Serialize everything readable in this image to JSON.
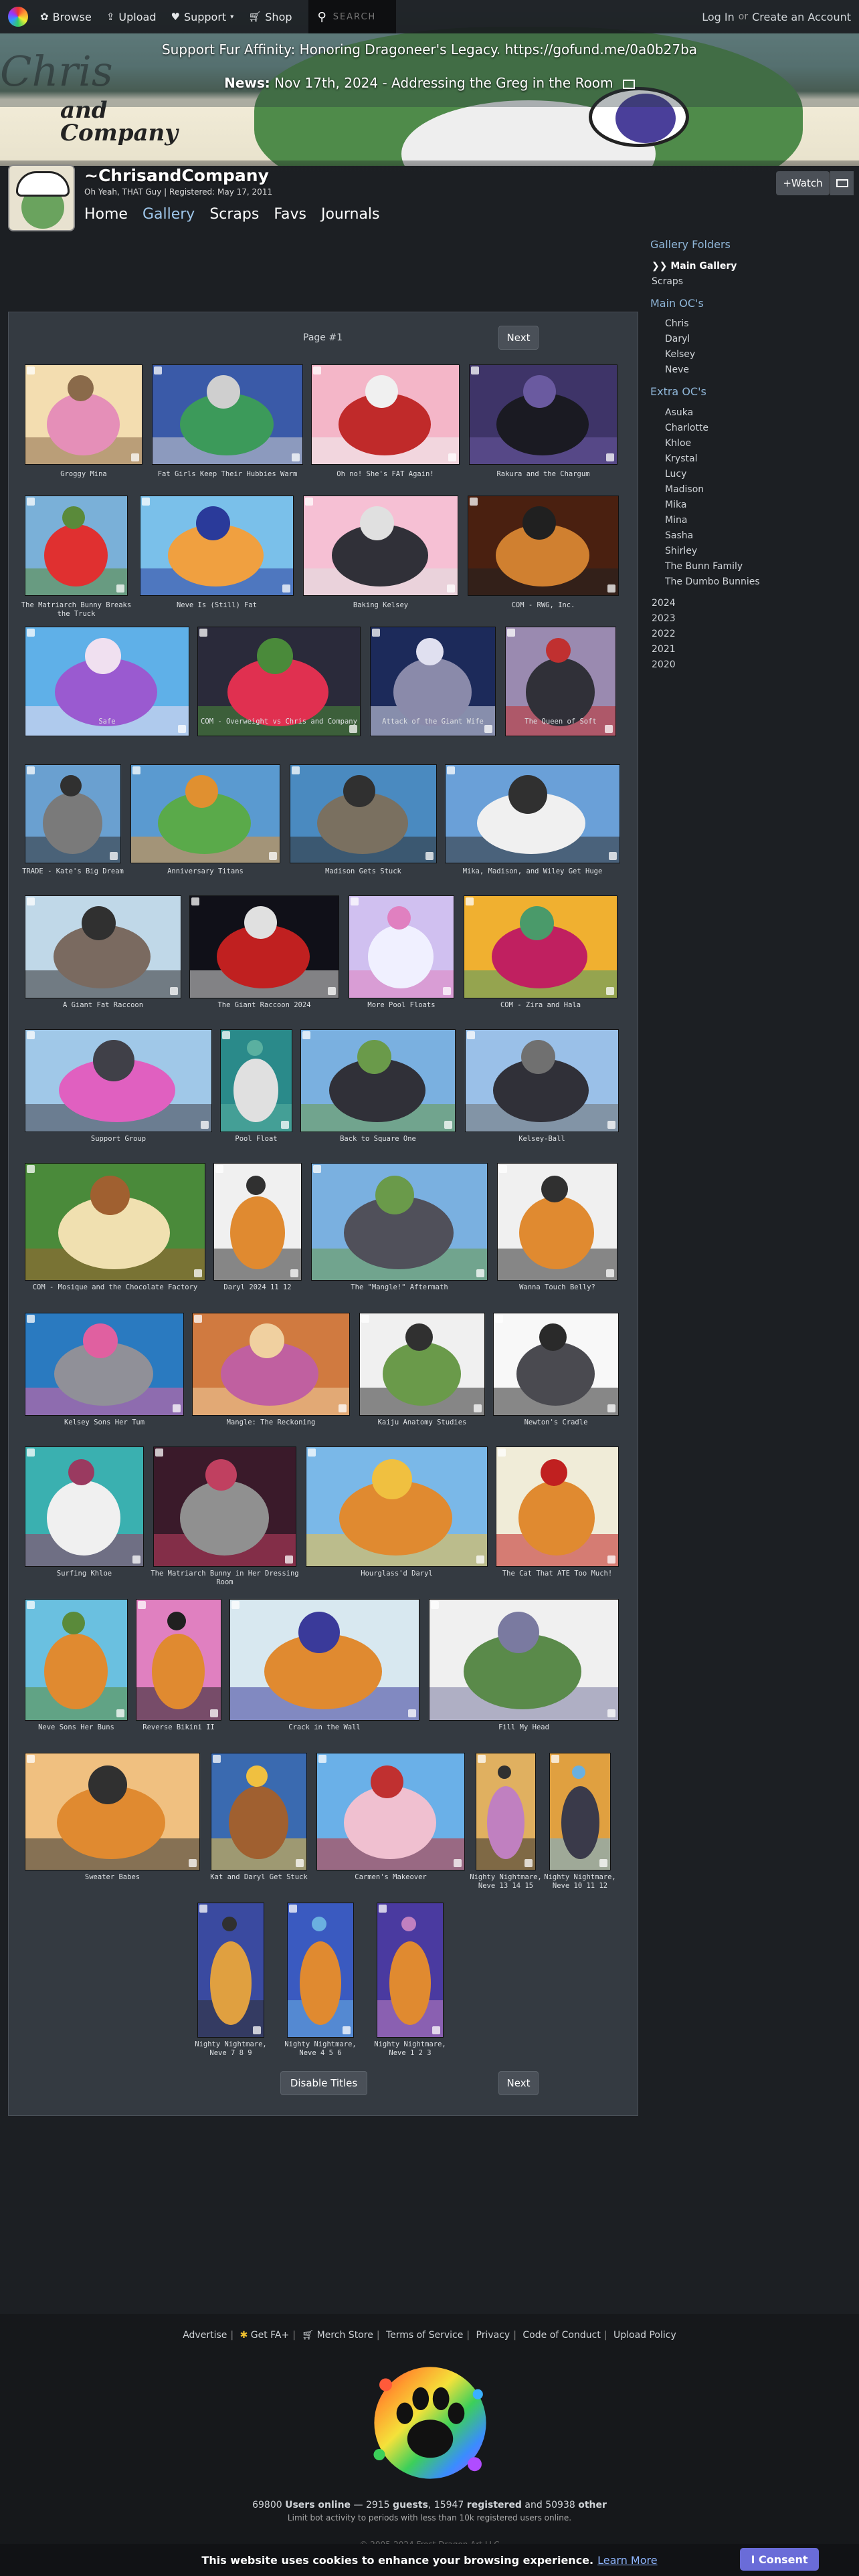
{
  "nav": {
    "browse": "Browse",
    "upload": "Upload",
    "support": "Support",
    "shop": "Shop",
    "search_placeholder": "SEARCH",
    "login": "Log In",
    "or": "or",
    "create_account": "Create an Account"
  },
  "banner": {
    "affinity": "Support Fur Affinity: Honoring Dragoneer's Legacy. https://gofund.me/0a0b27ba",
    "news_label": "News:",
    "news_text": "Nov 17th, 2024 - Addressing the Greg in the Room",
    "logo_line1": "Chris",
    "logo_line2": "and",
    "logo_line3": "Company"
  },
  "user": {
    "name": "~ChrisandCompany",
    "sub": "Oh Yeah, THAT Guy | Registered: May 17, 2011",
    "watch": "+Watch",
    "tabs": [
      "Home",
      "Gallery",
      "Scraps",
      "Favs",
      "Journals"
    ]
  },
  "gallery": {
    "page_label": "Page #1",
    "next": "Next",
    "disable_titles": "Disable Titles",
    "items": [
      {
        "title": "Groggy Mina",
        "colors": [
          "#f3ddb0",
          "#e58fb8",
          "#8a6a4a"
        ]
      },
      {
        "title": "Fat Girls Keep Their Hubbies Warm",
        "colors": [
          "#3a5aa8",
          "#3c9a5a",
          "#cfcfcf"
        ]
      },
      {
        "title": "Oh no! She's FAT Again!",
        "colors": [
          "#f4b6c8",
          "#c02a2a",
          "#f0f0f0"
        ]
      },
      {
        "title": "Rakura and the Chargum",
        "colors": [
          "#3e3468",
          "#1a1a22",
          "#6a5aa0"
        ]
      },
      {
        "title": "The Matriarch Bunny Breaks the Truck",
        "colors": [
          "#7ab0d8",
          "#e03030",
          "#5a8a3a"
        ]
      },
      {
        "title": "Neve Is (Still) Fat",
        "colors": [
          "#7ac0ea",
          "#f0a040",
          "#2a3a9a"
        ]
      },
      {
        "title": "Baking Kelsey",
        "colors": [
          "#f6c0d4",
          "#303038",
          "#e0e0e0"
        ]
      },
      {
        "title": "COM - RWG, Inc.",
        "colors": [
          "#4a2010",
          "#d08030",
          "#202020"
        ]
      },
      {
        "title": "Safe",
        "colors": [
          "#5fb0e8",
          "#9a5ad0",
          "#f0e0f0"
        ]
      },
      {
        "title": "COM - Overweight vs Chris and Company",
        "colors": [
          "#2a2a3a",
          "#e03050",
          "#4a8a3a"
        ]
      },
      {
        "title": "Attack of the Giant Wife",
        "colors": [
          "#1c2a5a",
          "#8a8aaa",
          "#e0e0f0"
        ]
      },
      {
        "title": "The Queen of Soft",
        "colors": [
          "#9a8ab0",
          "#303038",
          "#c03030"
        ]
      },
      {
        "title": "TRADE - Kate's Big Dream",
        "colors": [
          "#6aa0d0",
          "#7a7a7a",
          "#303030"
        ]
      },
      {
        "title": "Anniversary Titans",
        "colors": [
          "#5a9ad0",
          "#5aaa4a",
          "#e09030"
        ]
      },
      {
        "title": "Madison Gets Stuck",
        "colors": [
          "#4a8ac0",
          "#7a7060",
          "#303030"
        ]
      },
      {
        "title": "Mika, Madison, and Wiley Get Huge",
        "colors": [
          "#6aa0d8",
          "#f0f0f0",
          "#303030"
        ]
      },
      {
        "title": "A Giant Fat Raccoon",
        "colors": [
          "#c0d8e8",
          "#7a6a60",
          "#303030"
        ]
      },
      {
        "title": "The Giant Raccoon 2024",
        "colors": [
          "#101018",
          "#c02020",
          "#e0e0e0"
        ]
      },
      {
        "title": "More Pool Floats",
        "colors": [
          "#d0c0f0",
          "#f0f0ff",
          "#e080c0"
        ]
      },
      {
        "title": "COM - Zira and Hala",
        "colors": [
          "#f0b030",
          "#c02060",
          "#4a9a6a"
        ]
      },
      {
        "title": "Support Group",
        "colors": [
          "#a0c8e8",
          "#e060c0",
          "#404048"
        ]
      },
      {
        "title": "Pool Float",
        "colors": [
          "#2a8a8a",
          "#e0e0e0",
          "#5ab0a0"
        ]
      },
      {
        "title": "Back to Square One",
        "colors": [
          "#7ab0e0",
          "#303038",
          "#6a9a4a"
        ]
      },
      {
        "title": "Kelsey-Ball",
        "colors": [
          "#9ac0e8",
          "#303038",
          "#707070"
        ]
      },
      {
        "title": "COM - Mosique and the Chocolate Factory",
        "colors": [
          "#4a8a3a",
          "#f0e0b0",
          "#a06030"
        ]
      },
      {
        "title": "Daryl 2024 11 12",
        "colors": [
          "#f0f0f0",
          "#e08a30",
          "#303030"
        ]
      },
      {
        "title": "The \"Mangle!\" Aftermath",
        "colors": [
          "#7ab0e0",
          "#50505a",
          "#6a9a4a"
        ]
      },
      {
        "title": "Wanna Touch Belly?",
        "colors": [
          "#f0f0f0",
          "#e08a30",
          "#303030"
        ]
      },
      {
        "title": "Kelsey Sons Her Tum",
        "colors": [
          "#2a7ac0",
          "#909098",
          "#e060a0"
        ]
      },
      {
        "title": "Mangle: The Reckoning",
        "colors": [
          "#d07a40",
          "#c060a0",
          "#f0d0a0"
        ]
      },
      {
        "title": "Kaiju Anatomy Studies",
        "colors": [
          "#f0f0f0",
          "#6a9a4a",
          "#303030"
        ]
      },
      {
        "title": "Newton's Cradle",
        "colors": [
          "#f8f8f8",
          "#4a4a50",
          "#2a2a2a"
        ]
      },
      {
        "title": "Surfing Khloe",
        "colors": [
          "#3ab0b0",
          "#f0f0f0",
          "#9a3a60"
        ]
      },
      {
        "title": "The Matriarch Bunny in Her Dressing Room",
        "colors": [
          "#3a1a2a",
          "#909090",
          "#c04060"
        ]
      },
      {
        "title": "Hourglass'd Daryl",
        "colors": [
          "#7ab8e8",
          "#e08a30",
          "#f0c040"
        ]
      },
      {
        "title": "The Cat That ATE Too Much!",
        "colors": [
          "#f0ecd8",
          "#e08a30",
          "#c02020"
        ]
      },
      {
        "title": "Neve Sons Her Buns",
        "colors": [
          "#6ac0e0",
          "#e08a30",
          "#5a8a3a"
        ]
      },
      {
        "title": "Reverse Bikini II",
        "colors": [
          "#e080c0",
          "#e08a30",
          "#202020"
        ]
      },
      {
        "title": "Crack in the Wall",
        "colors": [
          "#d8e8f0",
          "#e08a30",
          "#3a3a9a"
        ]
      },
      {
        "title": "Fill My Head",
        "colors": [
          "#f0f0f0",
          "#5a8a4a",
          "#7a7aa0"
        ]
      },
      {
        "title": "Sweater Babes",
        "colors": [
          "#f0c080",
          "#e08a30",
          "#303030"
        ]
      },
      {
        "title": "Kat and Daryl Get Stuck",
        "colors": [
          "#3a6ab0",
          "#a06030",
          "#f0c040"
        ]
      },
      {
        "title": "Carmen's Makeover",
        "colors": [
          "#6ab0e8",
          "#f0c0d0",
          "#c03030"
        ]
      },
      {
        "title": "Nighty Nightmare, Neve 13 14 15",
        "colors": [
          "#e0b060",
          "#c080c0",
          "#303030"
        ]
      },
      {
        "title": "Nighty Nightmare, Neve 10 11 12",
        "colors": [
          "#e0a040",
          "#3a3a4a",
          "#6ab0e0"
        ]
      },
      {
        "title": "Nighty Nightmare, Neve 7 8 9",
        "colors": [
          "#3a4aa0",
          "#e0a040",
          "#303030"
        ]
      },
      {
        "title": "Nighty Nightmare, Neve 4 5 6",
        "colors": [
          "#3a5ac0",
          "#e08a30",
          "#6ab0e0"
        ]
      },
      {
        "title": "Nighty Nightmare, Neve 1 2 3",
        "colors": [
          "#4a3aa0",
          "#e08a30",
          "#c080c0"
        ]
      }
    ]
  },
  "sidebar": {
    "folders_heading": "Gallery Folders",
    "main_gallery": "❯❯ Main Gallery",
    "scraps": "Scraps",
    "main_ocs_heading": "Main OC's",
    "main_ocs": [
      "Chris",
      "Daryl",
      "Kelsey",
      "Neve"
    ],
    "extra_ocs_heading": "Extra OC's",
    "extra_ocs": [
      "Asuka",
      "Charlotte",
      "Khloe",
      "Krystal",
      "Lucy",
      "Madison",
      "Mika",
      "Mina",
      "Sasha",
      "Shirley",
      "The Bunn Family",
      "The Dumbo Bunnies"
    ],
    "years": [
      "2024",
      "2023",
      "2022",
      "2021",
      "2020"
    ]
  },
  "footer": {
    "links": [
      "Advertise",
      "Get FA+",
      "Merch Store",
      "Terms of Service",
      "Privacy",
      "Code of Conduct",
      "Upload Policy"
    ],
    "users_online_count": "69800",
    "users_online_label": "Users online",
    "guests": "2915",
    "guests_label": "guests",
    "registered": "15947",
    "registered_label": "registered",
    "other": "50938",
    "other_label": "other",
    "bot_note": "Limit bot activity to periods with less than 10k registered users online.",
    "copyright": "© 2005-2024 Frost Dragon Art LLC"
  },
  "cookie": {
    "text": "This website uses cookies to enhance your browsing experience.",
    "learn_more": "Learn More",
    "consent": "I Consent"
  }
}
